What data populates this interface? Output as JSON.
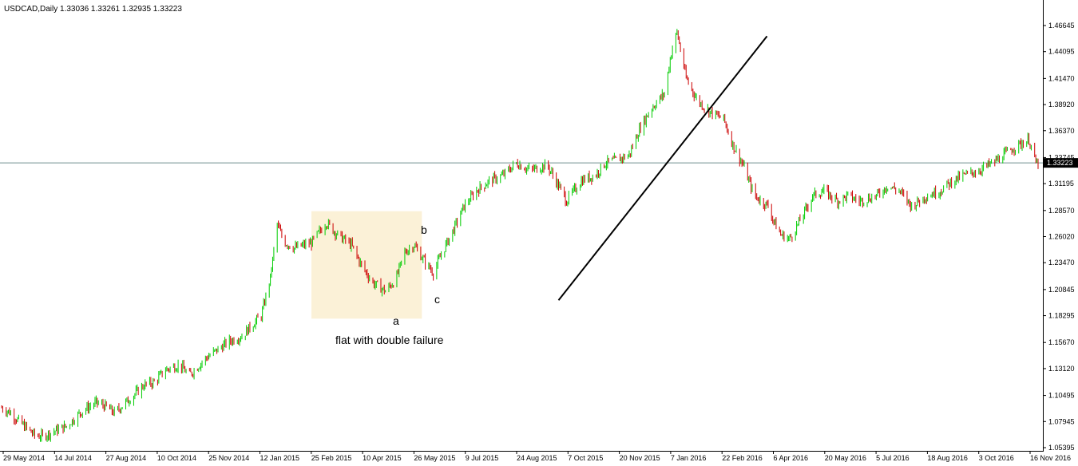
{
  "chart_data": {
    "type": "candlestick",
    "title": "USDCAD,Daily  1.33036 1.33261 1.32935 1.33223",
    "current_price": 1.33223,
    "current_price_label": "1.33223",
    "ylim": [
      1.05395,
      1.48
    ],
    "y_ticks": [
      "1.46645",
      "1.44095",
      "1.41470",
      "1.38920",
      "1.36370",
      "1.33745",
      "1.31195",
      "1.28570",
      "1.26020",
      "1.23470",
      "1.20845",
      "1.18295",
      "1.15670",
      "1.13120",
      "1.10495",
      "1.07945",
      "1.05395"
    ],
    "x_labels": [
      "29 May 2014",
      "14 Jul 2014",
      "27 Aug 2014",
      "10 Oct 2014",
      "25 Nov 2014",
      "12 Jan 2015",
      "25 Feb 2015",
      "10 Apr 2015",
      "26 May 2015",
      "9 Jul 2015",
      "24 Aug 2015",
      "7 Oct 2015",
      "20 Nov 2015",
      "7 Jan 2016",
      "22 Feb 2016",
      "6 Apr 2016",
      "20 May 2016",
      "5 Jul 2016",
      "18 Aug 2016",
      "3 Oct 2016",
      "16 Nov 2016"
    ],
    "series": [
      {
        "dates": [
          "2014-05-29",
          "2014-06-06",
          "2014-06-13",
          "2014-06-20",
          "2014-06-27",
          "2014-07-04",
          "2014-07-14",
          "2014-07-25",
          "2014-08-08",
          "2014-08-20",
          "2014-08-27",
          "2014-09-05",
          "2014-09-19",
          "2014-10-01",
          "2014-10-10",
          "2014-10-20",
          "2014-11-01",
          "2014-11-10",
          "2014-11-25",
          "2014-12-05",
          "2014-12-15",
          "2014-12-26",
          "2015-01-05",
          "2015-01-12",
          "2015-01-20",
          "2015-01-26",
          "2015-02-01",
          "2015-02-10",
          "2015-02-25",
          "2015-03-10",
          "2015-03-20",
          "2015-04-01",
          "2015-04-10",
          "2015-04-20",
          "2015-05-01",
          "2015-05-10",
          "2015-05-18",
          "2015-05-26",
          "2015-06-05",
          "2015-06-12",
          "2015-06-20",
          "2015-07-01",
          "2015-07-09",
          "2015-07-20",
          "2015-08-01",
          "2015-08-12",
          "2015-08-24",
          "2015-09-05",
          "2015-09-20",
          "2015-09-30",
          "2015-10-07",
          "2015-10-20",
          "2015-11-01",
          "2015-11-10",
          "2015-11-20",
          "2015-12-01",
          "2015-12-10",
          "2015-12-20",
          "2016-01-01",
          "2016-01-07",
          "2016-01-12",
          "2016-01-20",
          "2016-01-30",
          "2016-02-10",
          "2016-02-22",
          "2016-03-01",
          "2016-03-10",
          "2016-03-20",
          "2016-04-01",
          "2016-04-06",
          "2016-04-12",
          "2016-04-20",
          "2016-05-01",
          "2016-05-10",
          "2016-05-20",
          "2016-06-01",
          "2016-06-10",
          "2016-06-20",
          "2016-07-05",
          "2016-07-15",
          "2016-07-25",
          "2016-08-05",
          "2016-08-18",
          "2016-08-30",
          "2016-09-10",
          "2016-09-20",
          "2016-10-03",
          "2016-10-15",
          "2016-10-25",
          "2016-11-04",
          "2016-11-16",
          "2016-11-22"
        ],
        "close": [
          1.093,
          1.088,
          1.08,
          1.073,
          1.066,
          1.065,
          1.07,
          1.075,
          1.09,
          1.098,
          1.095,
          1.088,
          1.102,
          1.115,
          1.118,
          1.13,
          1.135,
          1.125,
          1.142,
          1.15,
          1.158,
          1.163,
          1.175,
          1.183,
          1.22,
          1.272,
          1.255,
          1.249,
          1.254,
          1.274,
          1.262,
          1.252,
          1.232,
          1.215,
          1.207,
          1.218,
          1.245,
          1.252,
          1.235,
          1.225,
          1.245,
          1.27,
          1.29,
          1.305,
          1.315,
          1.32,
          1.332,
          1.325,
          1.33,
          1.31,
          1.295,
          1.315,
          1.32,
          1.332,
          1.335,
          1.34,
          1.365,
          1.385,
          1.4,
          1.44,
          1.46,
          1.415,
          1.393,
          1.382,
          1.375,
          1.35,
          1.33,
          1.3,
          1.29,
          1.275,
          1.262,
          1.258,
          1.28,
          1.3,
          1.305,
          1.295,
          1.3,
          1.295,
          1.3,
          1.31,
          1.305,
          1.29,
          1.3,
          1.305,
          1.315,
          1.32,
          1.325,
          1.332,
          1.34,
          1.348,
          1.355,
          1.332
        ]
      }
    ],
    "annotations": [
      {
        "text": "flat with double failure"
      },
      {
        "text": "a"
      },
      {
        "text": "b"
      },
      {
        "text": "c"
      }
    ],
    "trendline": {
      "from": {
        "date": "2015-09-30",
        "price": 1.198
      },
      "to": {
        "date": "2016-03-31",
        "price": 1.456
      }
    },
    "highlight": {
      "from": "2015-02-25",
      "to": "2015-06-02",
      "price_top": 1.285,
      "price_bottom": 1.18
    },
    "colors": {
      "bull": "#00cc00",
      "bear": "#cc0000",
      "hline": "#6f8f8f",
      "trendline": "#000000",
      "box": "#fbf1d7",
      "axis": "#000000"
    }
  }
}
